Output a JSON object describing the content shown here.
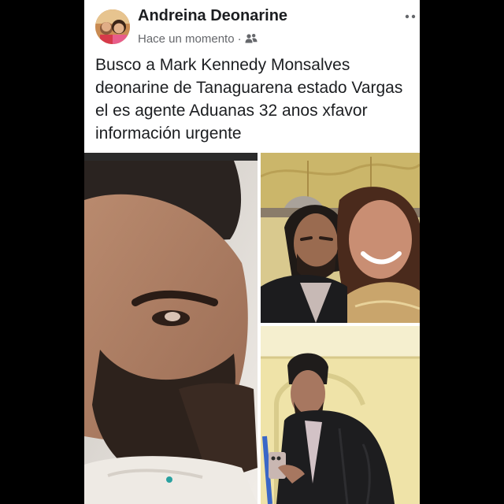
{
  "post": {
    "author": "Andreina Deonarine",
    "timestamp": "Hace un momento",
    "separator": "·",
    "audience_icon": "friends-icon",
    "more_icon": "more-options-icon",
    "text": "Busco a Mark Kennedy Monsalves deonarine de Tanaguarena estado Vargas el es agente Aduanas 32 anos xfavor información urgente"
  },
  "photos": [
    {
      "name": "photo-selfie-closeup"
    },
    {
      "name": "photo-selfie-with-woman"
    },
    {
      "name": "photo-man-with-phone"
    }
  ],
  "colors": {
    "author": "#1c1e21",
    "meta": "#65676b",
    "background": "#ffffff"
  }
}
